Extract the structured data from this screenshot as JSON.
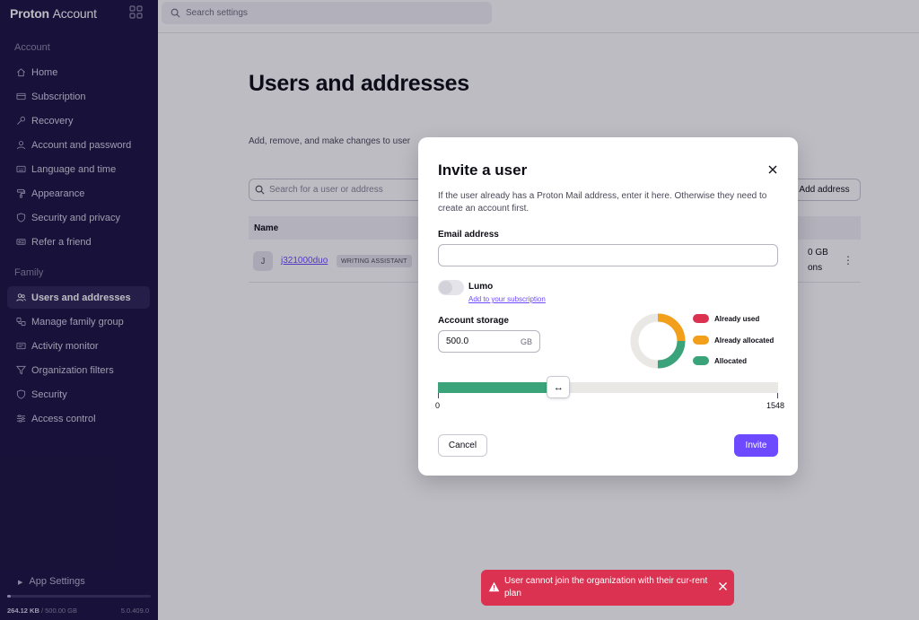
{
  "sidebar": {
    "brand_bold": "Proton",
    "brand_light": "Account",
    "account_section": "Account",
    "account_items": [
      {
        "label": "Home"
      },
      {
        "label": "Subscription"
      },
      {
        "label": "Recovery"
      },
      {
        "label": "Account and password"
      },
      {
        "label": "Language and time"
      },
      {
        "label": "Appearance"
      },
      {
        "label": "Security and privacy"
      },
      {
        "label": "Refer a friend"
      }
    ],
    "family_section": "Family",
    "family_items": [
      {
        "label": "Users and addresses"
      },
      {
        "label": "Manage family group"
      },
      {
        "label": "Activity monitor"
      },
      {
        "label": "Organization filters"
      },
      {
        "label": "Security"
      },
      {
        "label": "Access control"
      }
    ],
    "app_settings": "App Settings",
    "storage_used": "264.12 KB",
    "storage_total": " / 500.00 GB",
    "version": "5.0.409.0"
  },
  "topbar": {
    "search_placeholder": "Search settings"
  },
  "page": {
    "title": "Users and addresses",
    "description": "Add, remove, and make changes to user",
    "user_search_placeholder": "Search for a user or address",
    "add_address": "Add address",
    "table_header_name": "Name",
    "row": {
      "avatar": "J",
      "name": "j321000duo",
      "badge": "WRITING ASSISTANT",
      "storage_partial": "0 GB",
      "roles_partial": "ons",
      "menu": "⋮"
    }
  },
  "modal": {
    "title": "Invite a user",
    "description": "If the user already has a Proton Mail address, enter it here. Otherwise they need to create an account first.",
    "email_label": "Email address",
    "email_value": "",
    "lumo_label": "Lumo",
    "lumo_link": "Add to your subscription",
    "storage_label": "Account storage",
    "storage_value": "500.0",
    "storage_unit": "GB",
    "legend": [
      {
        "label": "Already used",
        "color": "#dc3251"
      },
      {
        "label": "Already allocated",
        "color": "#f2a01c"
      },
      {
        "label": "Allocated",
        "color": "#3aa37a"
      }
    ],
    "slider": {
      "min": "0",
      "max": "1548",
      "value": 500,
      "handle_glyph": "↔"
    },
    "cancel": "Cancel",
    "invite": "Invite"
  },
  "toast": {
    "message": "User cannot join the organization with their cur-rent plan",
    "color": "#dc3251"
  }
}
